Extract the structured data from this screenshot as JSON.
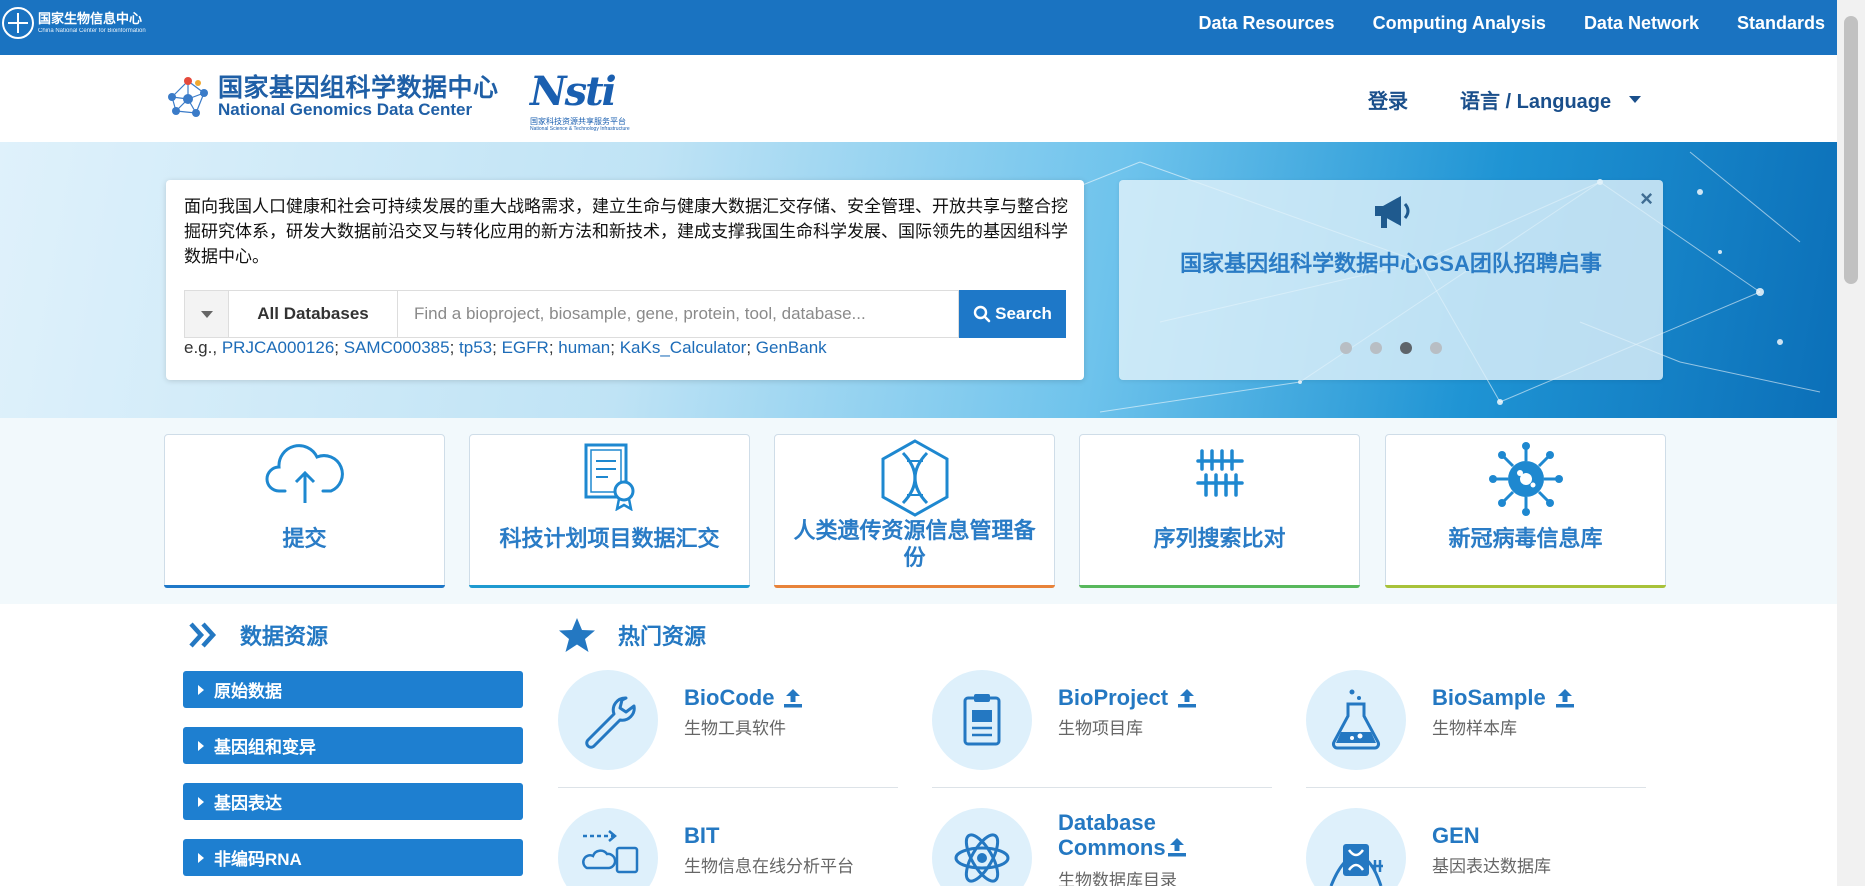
{
  "topbar": {
    "logo_cn": "国家生物信息中心",
    "logo_en": "China National Center for Bioinformation",
    "nav": [
      "Data Resources",
      "Computing Analysis",
      "Data Network",
      "Standards"
    ]
  },
  "header": {
    "logo_cn": "国家基因组科学数据中心",
    "logo_en": "National Genomics Data Center",
    "nsti_word": "Nsti",
    "nsti_cn": "国家科技资源共享服务平台",
    "nsti_en": "National Science & Technology Infrastructure",
    "login": "登录",
    "language": "语言 / Language"
  },
  "hero": {
    "intro": "面向我国人口健康和社会可持续发展的重大战略需求，建立生命与健康大数据汇交存储、安全管理、开放共享与整合挖掘研究体系，研发大数据前沿交叉与转化应用的新方法和新技术，建成支撑我国生命科学发展、国际领先的基因组科学数据中心。",
    "db_select": "All Databases",
    "search_placeholder": "Find a bioproject, biosample, gene, protein, tool, database...",
    "search_button": "Search",
    "examples_prefix": "e.g.,",
    "examples": [
      "PRJCA000126",
      "SAMC000385",
      "tp53",
      "EGFR",
      "human",
      "KaKs_Calculator",
      "GenBank"
    ]
  },
  "notice": {
    "title": "国家基因组科学数据中心GSA团队招聘启事",
    "close": "×",
    "slide_count": 4,
    "active_slide": 3
  },
  "feature_cards": [
    {
      "label": "提交",
      "icon": "cloud-upload-icon",
      "accent": "#1e78c8"
    },
    {
      "label": "科技计划项目数据汇交",
      "icon": "certificate-icon",
      "accent": "#1e9ad0"
    },
    {
      "label": "人类遗传资源信息管理备份",
      "icon": "dna-hexagon-icon",
      "accent": "#e8833a"
    },
    {
      "label": "序列搜索比对",
      "icon": "sequence-align-icon",
      "accent": "#58b85c"
    },
    {
      "label": "新冠病毒信息库",
      "icon": "virus-icon",
      "accent": "#a8c23a"
    }
  ],
  "data_resources": {
    "title": "数据资源",
    "categories": [
      "原始数据",
      "基因组和变异",
      "基因表达",
      "非编码RNA"
    ]
  },
  "hot_resources": {
    "title": "热门资源",
    "items": [
      {
        "name": "BioCode",
        "desc": "生物工具软件",
        "icon": "wrench-icon",
        "upload": true
      },
      {
        "name": "BioProject",
        "desc": "生物项目库",
        "icon": "clipboard-icon",
        "upload": true
      },
      {
        "name": "BioSample",
        "desc": "生物样本库",
        "icon": "flask-icon",
        "upload": true
      },
      {
        "name": "BIT",
        "desc": "生物信息在线分析平台",
        "icon": "workflow-icon",
        "upload": false
      },
      {
        "name": "Database Commons",
        "desc": "生物数据库目录",
        "icon": "atom-icon",
        "upload": true
      },
      {
        "name": "GEN",
        "desc": "基因表达数据库",
        "icon": "gene-expression-icon",
        "upload": false
      }
    ]
  },
  "colors": {
    "brand": "#1a73c1",
    "accent": "#2478c2"
  }
}
